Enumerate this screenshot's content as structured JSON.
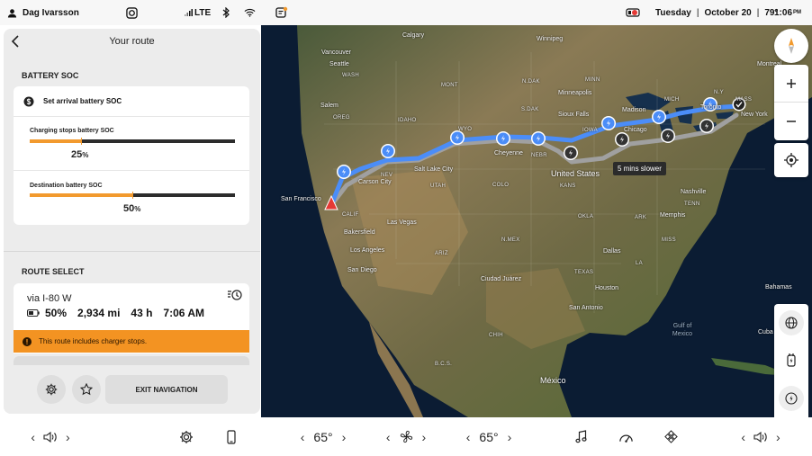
{
  "status_bar": {
    "user_name": "Dag Ivarsson",
    "network": "LTE",
    "day": "Tuesday",
    "date": "October 20",
    "temperature": "79°",
    "time": "1:06",
    "ampm": "PM"
  },
  "panel": {
    "title": "Your route",
    "battery_section_title": "BATTERY SOC",
    "set_arrival_label": "Set arrival battery SOC",
    "charging_stops_label": "Charging stops battery SOC",
    "charging_stops_value": "25",
    "charging_stops_fraction": 0.25,
    "destination_label": "Destination battery SOC",
    "destination_value": "50",
    "destination_fraction": 0.5,
    "percent_unit": "%",
    "route_section_title": "ROUTE SELECT",
    "route": {
      "name": "via I-80 W",
      "battery": "50%",
      "distance": "2,934 mi",
      "duration": "43 h",
      "arrival": "7:06 AM"
    },
    "warning": "This route includes charger stops.",
    "exit_label": "EXIT NAVIGATION"
  },
  "map": {
    "alt_route_badge": "5 mins slower",
    "labels": {
      "calgary": "Calgary",
      "winnipeg": "Winnipeg",
      "montreal": "Montreal",
      "vancouver": "Vancouver",
      "seattle": "Seattle",
      "wash": "WASH",
      "mont": "MONT",
      "ndak": "N.DAK",
      "minn": "MINN",
      "mich": "MICH",
      "ny": "N.Y",
      "mass": "MASS",
      "salem": "Salem",
      "oreg": "OREG",
      "idaho": "IDAHO",
      "wyo": "WYO",
      "sdak": "S.DAK",
      "minneapolis": "Minneapolis",
      "madison": "Madison",
      "toronto": "Toronto",
      "siouxfalls": "Sioux Falls",
      "iowa": "IOWA",
      "chicago": "Chicago",
      "newyork": "New York",
      "nev": "NEV",
      "saltlake": "Salt Lake City",
      "utah": "UTAH",
      "colo": "COLO",
      "cheyenne": "Cheyenne",
      "nebr": "NEBR",
      "unitedstates": "United States",
      "kans": "KANS",
      "sanfrancisco": "San Francisco",
      "carson": "Carson City",
      "calif": "CALIF",
      "lasvegas": "Las Vegas",
      "bakersfield": "Bakersfield",
      "losangeles": "Los Angeles",
      "sandiego": "San Diego",
      "ariz": "ARIZ",
      "nmex": "N.MEX",
      "okla": "OKLA",
      "ark": "ARK",
      "memphis": "Memphis",
      "miss": "MISS",
      "dallas": "Dallas",
      "texas": "TEXAS",
      "houston": "Houston",
      "sanantonio": "San Antonio",
      "ciudadjuarez": "Ciudad Juárez",
      "bcs": "B.C.S.",
      "chih": "CHIH",
      "mexico": "México",
      "gulf": "Gulf of Mexico",
      "bahamas": "Bahamas",
      "cuba": "Cuba",
      "nash": "Nashville",
      "la": "LA",
      "tenn": "TENN"
    }
  },
  "bottom_bar": {
    "driver_temp": "65°",
    "passenger_temp": "65°"
  },
  "icons": {
    "back": "chevron-left-icon",
    "compass": "compass-icon",
    "zoom_in": "plus-icon",
    "zoom_out": "minus-icon",
    "locate": "locate-icon",
    "globe": "globe-icon",
    "charger": "charger-icon",
    "speed": "gauge-icon",
    "settings": "gear-icon",
    "star": "star-icon",
    "phone": "phone-icon",
    "fan": "fan-icon",
    "music": "music-icon",
    "apps": "apps-icon",
    "volume": "volume-icon",
    "history": "route-history-icon",
    "warning": "alert-icon"
  },
  "colors": {
    "accent_orange": "#f29a2e",
    "route_blue": "#4b8df8",
    "alt_route_gray": "#a0a0a0",
    "destination_red": "#e53935"
  }
}
